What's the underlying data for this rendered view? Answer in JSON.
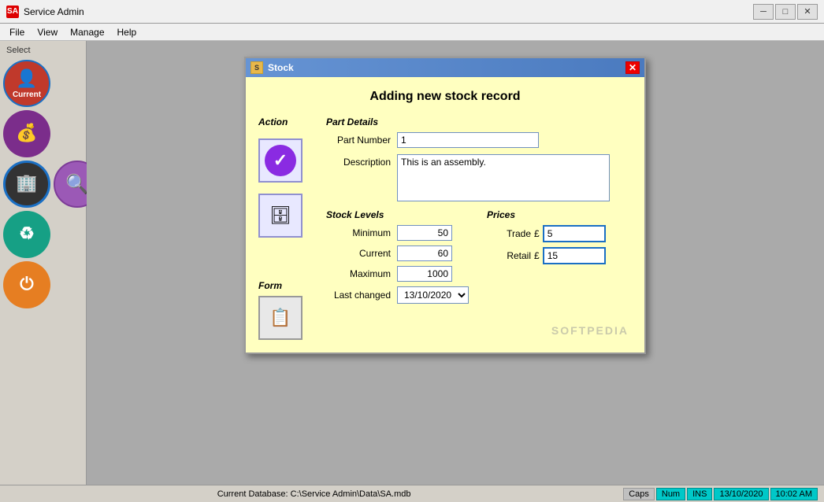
{
  "app": {
    "title": "Service Admin",
    "icon_label": "SA"
  },
  "titlebar_controls": {
    "minimize": "─",
    "maximize": "□",
    "close": "✕"
  },
  "menubar": {
    "items": [
      "File",
      "View",
      "Manage",
      "Help"
    ]
  },
  "sidebar": {
    "label": "Select",
    "buttons": [
      {
        "id": "current",
        "label": "Current",
        "color": "btn-red",
        "icon": "👤",
        "active": true
      },
      {
        "id": "money",
        "label": "",
        "color": "btn-purple",
        "icon": "💰",
        "active": false
      },
      {
        "id": "org",
        "label": "",
        "color": "btn-dark",
        "icon": "🏢",
        "active": true
      },
      {
        "id": "teal",
        "label": "",
        "color": "btn-teal",
        "icon": "♻",
        "active": false
      },
      {
        "id": "power",
        "label": "",
        "color": "btn-orange-dark",
        "icon": "⏻",
        "active": false
      }
    ],
    "search_btn": "🔍",
    "add_btn": "+"
  },
  "modal": {
    "title": "Stock",
    "icon_label": "S",
    "heading": "Adding new stock record",
    "action_section_title": "Action",
    "form_section_title": "Form",
    "part_details": {
      "section_title": "Part Details",
      "part_number_label": "Part Number",
      "part_number_value": "1",
      "description_label": "Description",
      "description_value": "This is an assembly."
    },
    "stock_levels": {
      "section_title": "Stock Levels",
      "minimum_label": "Minimum",
      "minimum_value": "50",
      "current_label": "Current",
      "current_value": "60",
      "maximum_label": "Maximum",
      "maximum_value": "1000",
      "last_changed_label": "Last changed",
      "last_changed_value": "13/10/2020"
    },
    "prices": {
      "section_title": "Prices",
      "trade_label": "Trade",
      "trade_currency": "£",
      "trade_value": "5",
      "retail_label": "Retail",
      "retail_currency": "£",
      "retail_value": "15"
    }
  },
  "statusbar": {
    "database_label": "Current Database: C:\\Service Admin\\Data\\SA.mdb",
    "caps": "Caps",
    "num": "Num",
    "ins": "INS",
    "date": "13/10/2020",
    "time": "10:02 AM"
  }
}
